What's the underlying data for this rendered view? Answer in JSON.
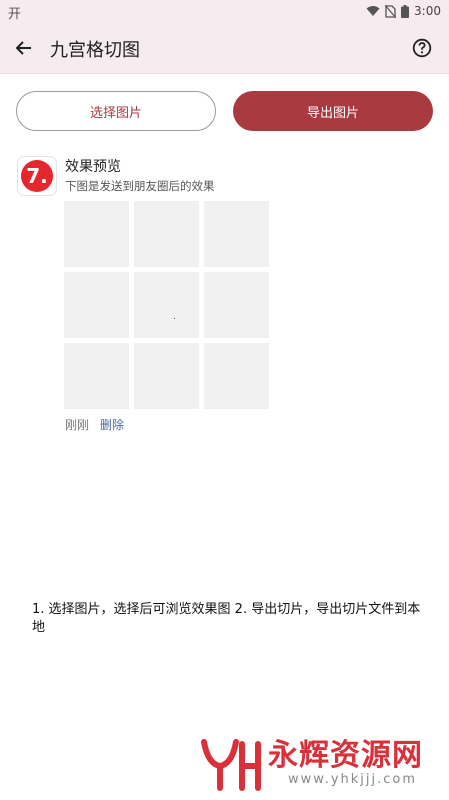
{
  "status_bar": {
    "left_icon": "notification-icon",
    "time": "3:00",
    "icons": [
      "wifi-icon",
      "no-sim-icon",
      "battery-icon"
    ]
  },
  "app_bar": {
    "back_icon": "arrow-back-icon",
    "title": "九宫格切图",
    "help_icon": "help-circle-icon"
  },
  "actions": {
    "select_label": "选择图片",
    "export_label": "导出图片",
    "accent_color": "#a83a40"
  },
  "preview_post": {
    "logo_text": "7.",
    "title": "效果预览",
    "subtitle": "下图是发送到朋友圈后的效果",
    "grid_cells": 9,
    "time_label": "刚刚",
    "delete_label": "删除"
  },
  "instructions": "1. 选择图片，选择后可浏览效果图 2. 导出切片，导出切片文件到本地",
  "watermark": {
    "logo_text": "YH",
    "text": "永辉资源网",
    "url": "www.yhkjjj.com"
  }
}
